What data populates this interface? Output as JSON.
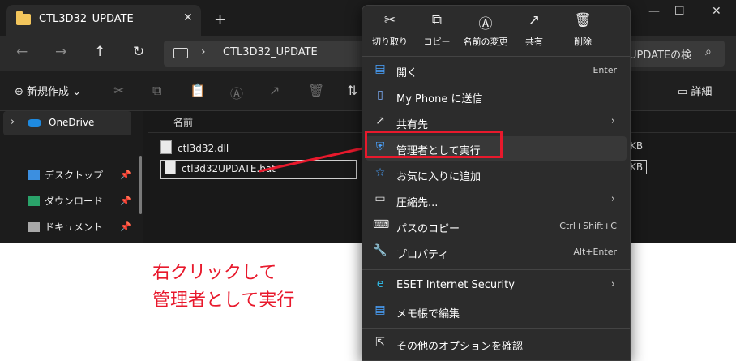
{
  "window": {
    "tab_title": "CTL3D32_UPDATE",
    "tab_close": "✕",
    "new_tab": "+",
    "controls": [
      "—",
      "☐",
      "✕"
    ]
  },
  "address": {
    "nav": [
      "←",
      "→",
      "↑",
      "↻"
    ],
    "chevron": "›",
    "path": "CTL3D32_UPDATE",
    "search_text": "UPDATEの検",
    "search_icon": "⌕"
  },
  "toolbar": {
    "new_label": "⊕ 新規作成 ⌄",
    "icons": [
      "✂",
      "⧉",
      "📋",
      "Ⓐ",
      "↗",
      "🗑",
      "⇅"
    ],
    "detail_label": "詳細"
  },
  "sidebar": {
    "onedrive_arrow": "›",
    "onedrive": "OneDrive",
    "items": [
      {
        "label": "デスクトップ",
        "color": "#3c8fe0"
      },
      {
        "label": "ダウンロード",
        "color": "#2aa36a"
      },
      {
        "label": "ドキュメント",
        "color": "#a8a8a8"
      }
    ],
    "pin_icon": "📌"
  },
  "content": {
    "column_name": "名前",
    "files": [
      {
        "name": "ctl3d32.dll",
        "size": "KB"
      },
      {
        "name": "ctl3d32UPDATE.bat",
        "size": "KB"
      }
    ]
  },
  "quick_actions": [
    {
      "icon": "✂",
      "label": "切り取り"
    },
    {
      "icon": "⧉",
      "label": "コピー"
    },
    {
      "icon": "Ⓐ",
      "label": "名前の変更"
    },
    {
      "icon": "↗",
      "label": "共有"
    },
    {
      "icon": "🗑",
      "label": "削除"
    }
  ],
  "menu": [
    {
      "icon": "▤",
      "icon_color": "#4aa3ff",
      "label": "開く",
      "shortcut": "Enter",
      "arrow": ""
    },
    {
      "icon": "▯",
      "icon_color": "#7fb2ff",
      "label": "My Phone に送信",
      "shortcut": "",
      "arrow": ""
    },
    {
      "icon": "↗",
      "icon_color": "#e6e6e6",
      "label": "共有先",
      "shortcut": "",
      "arrow": "›"
    },
    {
      "icon": "⛨",
      "icon_color": "#4aa3ff",
      "label": "管理者として実行",
      "shortcut": "",
      "arrow": ""
    },
    {
      "icon": "☆",
      "icon_color": "#4aa3ff",
      "label": "お気に入りに追加",
      "shortcut": "",
      "arrow": ""
    },
    {
      "icon": "▭",
      "icon_color": "#e6e6e6",
      "label": "圧縮先...",
      "shortcut": "",
      "arrow": "›"
    },
    {
      "icon": "⌨",
      "icon_color": "#e6e6e6",
      "label": "パスのコピー",
      "shortcut": "Ctrl+Shift+C",
      "arrow": ""
    },
    {
      "icon": "🔧",
      "icon_color": "#e6e6e6",
      "label": "プロパティ",
      "shortcut": "Alt+Enter",
      "arrow": ""
    },
    {
      "icon": "e",
      "icon_color": "#2fb5e0",
      "label": "ESET Internet Security",
      "shortcut": "",
      "arrow": "›"
    },
    {
      "icon": "▤",
      "icon_color": "#4aa3ff",
      "label": "メモ帳で編集",
      "shortcut": "",
      "arrow": ""
    },
    {
      "icon": "⇱",
      "icon_color": "#e6e6e6",
      "label": "その他のオプションを確認",
      "shortcut": "",
      "arrow": ""
    }
  ],
  "annotation": {
    "line1": "右クリックして",
    "line2": "管理者として実行",
    "color": "#e8192c"
  }
}
